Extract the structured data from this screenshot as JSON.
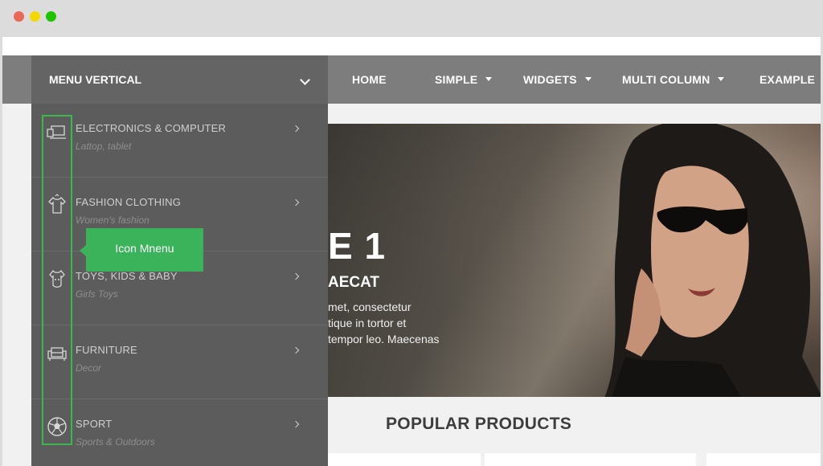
{
  "window": {
    "controls": [
      "close",
      "minimize",
      "maximize"
    ]
  },
  "nav": {
    "items": [
      {
        "label": "HOME",
        "has_dropdown": false
      },
      {
        "label": "SIMPLE",
        "has_dropdown": true
      },
      {
        "label": "WIDGETS",
        "has_dropdown": true
      },
      {
        "label": "MULTI COLUMN",
        "has_dropdown": true
      },
      {
        "label": "EXAMPLE",
        "has_dropdown": false
      }
    ]
  },
  "vertical_menu": {
    "title": "MENU VERTICAL",
    "items": [
      {
        "label": "ELECTRONICS & COMPUTER",
        "sub": "Lattop, tablet",
        "icon": "laptop-icon"
      },
      {
        "label": "FASHION CLOTHING",
        "sub": "Women's fashion",
        "icon": "shirt-icon"
      },
      {
        "label": "TOYS, KIDS & BABY",
        "sub": "Girls Toys",
        "icon": "baby-bodysuit-icon"
      },
      {
        "label": "FURNITURE",
        "sub": "Decor",
        "icon": "armchair-icon"
      },
      {
        "label": "SPORT",
        "sub": "Sports & Outdoors",
        "icon": "soccer-ball-icon"
      }
    ]
  },
  "tooltip": {
    "text": "Icon Mnenu"
  },
  "hero": {
    "title": "E 1",
    "subtitle": "AECAT",
    "lines": [
      "met, consectetur",
      "tique in tortor et",
      "tempor leo. Maecenas"
    ]
  },
  "section": {
    "title": "POPULAR PRODUCTS"
  },
  "colors": {
    "nav_bg": "#7d7d7d",
    "menu_bg": "#5c5c5c",
    "accent_green": "#3ab35a"
  }
}
